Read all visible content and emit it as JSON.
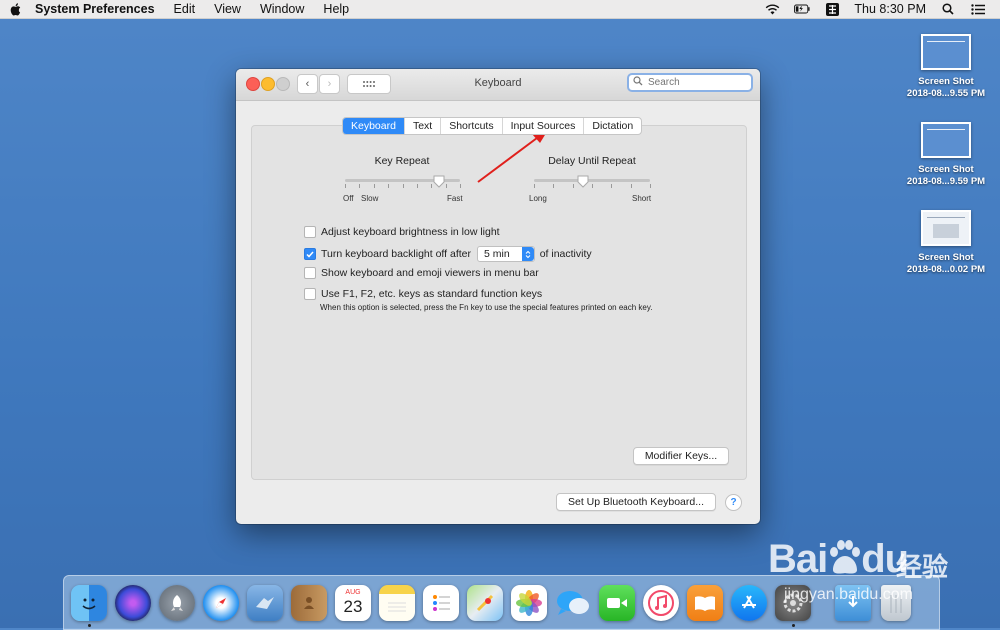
{
  "menubar": {
    "app_name": "System Preferences",
    "menus": [
      "Edit",
      "View",
      "Window",
      "Help"
    ],
    "clock": "Thu 8:30 PM",
    "icons": [
      "apple-icon",
      "wifi-icon",
      "battery-icon",
      "input-menu-icon",
      "search-icon",
      "list-icon"
    ]
  },
  "desktop": {
    "icons": [
      {
        "line1": "Screen Shot",
        "line2": "2018-08...9.55 PM"
      },
      {
        "line1": "Screen Shot",
        "line2": "2018-08...9.59 PM"
      },
      {
        "line1": "Screen Shot",
        "line2": "2018-08...0.02 PM"
      }
    ]
  },
  "window": {
    "title": "Keyboard",
    "search_placeholder": "Search",
    "tabs": [
      "Keyboard",
      "Text",
      "Shortcuts",
      "Input Sources",
      "Dictation"
    ],
    "active_tab": "Keyboard",
    "key_repeat": {
      "label": "Key Repeat",
      "left": "Off",
      "left2": "Slow",
      "right": "Fast",
      "value_fraction": 0.82
    },
    "delay_until_repeat": {
      "label": "Delay Until Repeat",
      "left": "Long",
      "right": "Short",
      "value_fraction": 0.42
    },
    "options": [
      {
        "label": "Adjust keyboard brightness in low light",
        "checked": false
      },
      {
        "label": "Turn keyboard backlight off after",
        "checked": true,
        "select_value": "5 min",
        "suffix": "of inactivity"
      },
      {
        "label": "Show keyboard and emoji viewers in menu bar",
        "checked": false
      },
      {
        "label": "Use F1, F2, etc. keys as standard function keys",
        "checked": false
      }
    ],
    "fn_note": "When this option is selected, press the Fn key to use the special features printed on each key.",
    "modifier_button": "Modifier Keys...",
    "bluetooth_button": "Set Up Bluetooth Keyboard...",
    "help": "?"
  },
  "colors": {
    "accent": "#2f8af7",
    "annotation_arrow": "#e0201c"
  },
  "dock": {
    "apps": [
      "finder-icon",
      "siri-icon",
      "launchpad-icon",
      "safari-icon",
      "mail-icon",
      "contacts-icon",
      "calendar-icon",
      "notes-icon",
      "reminders-icon",
      "maps-icon",
      "photos-icon",
      "messages-icon",
      "facetime-icon",
      "music-icon",
      "books-icon",
      "app-store-icon",
      "system-preferences-icon",
      "downloads-icon",
      "trash-icon"
    ],
    "calendar_month": "AUG",
    "calendar_day": "23"
  },
  "watermark": {
    "brand": "Bai",
    "brand2": "du",
    "chinese": "经验",
    "url": "jingyan.baidu.com"
  }
}
